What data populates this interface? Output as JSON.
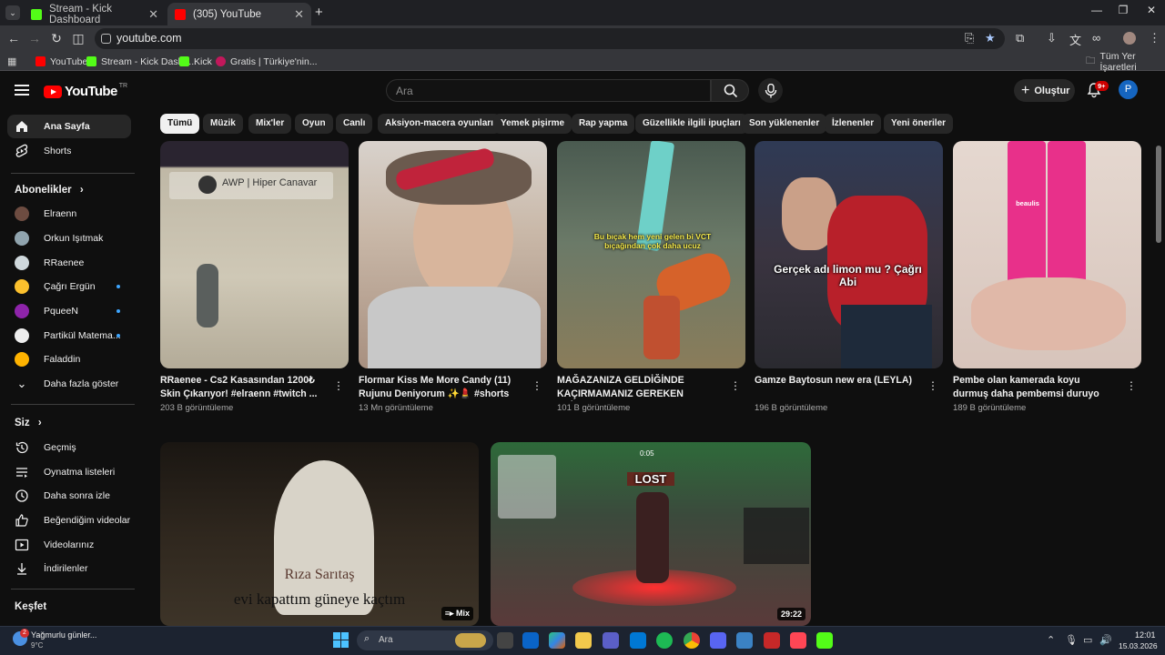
{
  "browser": {
    "tabs": [
      {
        "title": "Stream - Kick Dashboard",
        "favicon": "kick-icon",
        "active": false
      },
      {
        "title": "(305) YouTube",
        "favicon": "youtube-icon",
        "active": true
      }
    ],
    "new_tab": "+",
    "url": "youtube.com",
    "bookmarks": [
      {
        "label": "YouTube",
        "color": "#ff0000"
      },
      {
        "label": "Stream - Kick Dashb...",
        "color": "#53fc18"
      },
      {
        "label": "Kick",
        "color": "#53fc18"
      },
      {
        "label": "Gratis | Türkiye'nin...",
        "color": "#c2185b"
      }
    ],
    "all_bookmarks": "Tüm Yer İşaretleri"
  },
  "yt": {
    "logo_text": "YouTube",
    "country": "TR",
    "search_placeholder": "Ara",
    "create_label": "Oluştur",
    "notif_badge": "9+",
    "avatar_letter": "P"
  },
  "sidebar": {
    "main": [
      {
        "label": "Ana Sayfa",
        "icon": "home-icon",
        "active": true
      },
      {
        "label": "Shorts",
        "icon": "shorts-icon",
        "active": false
      }
    ],
    "subs_title": "Abonelikler",
    "subs": [
      {
        "label": "Elraenn",
        "color": "#6d4c41",
        "dot": false
      },
      {
        "label": "Orkun Işıtmak",
        "color": "#90a4ae",
        "dot": false
      },
      {
        "label": "RRaenee",
        "color": "#cfd8dc",
        "dot": false
      },
      {
        "label": "Çağrı Ergün",
        "color": "#fbc02d",
        "dot": true
      },
      {
        "label": "PqueeN",
        "color": "#8e24aa",
        "dot": true
      },
      {
        "label": "Partikül Matema...",
        "color": "#eeeeee",
        "dot": true
      },
      {
        "label": "Faladdin",
        "color": "#ffb300",
        "dot": false
      }
    ],
    "show_more": "Daha fazla göster",
    "you_title": "Siz",
    "you": [
      {
        "label": "Geçmiş",
        "icon": "history-icon"
      },
      {
        "label": "Oynatma listeleri",
        "icon": "playlist-icon"
      },
      {
        "label": "Daha sonra izle",
        "icon": "clock-icon"
      },
      {
        "label": "Beğendiğim videolar",
        "icon": "like-icon"
      },
      {
        "label": "Videolarınız",
        "icon": "video-icon"
      },
      {
        "label": "İndirilenler",
        "icon": "download-icon"
      }
    ],
    "explore_title": "Keşfet"
  },
  "chips": [
    "Tümü",
    "Müzik",
    "Mix'ler",
    "Oyun",
    "Canlı",
    "Aksiyon-macera oyunları",
    "Yemek pişirme",
    "Rap yapma",
    "Güzellikle ilgili ipuçları",
    "Son yüklenenler",
    "İzlenenler",
    "Yeni öneriler"
  ],
  "shorts": [
    {
      "title": "RRaenee - Cs2 Kasasından 1200₺ Skin Çıkarıyor! #elraenn #twitch ...",
      "views": "203 B görüntüleme",
      "overlay": "AWP | Hiper Canavar"
    },
    {
      "title": "Flormar Kiss Me More Candy (11) Rujunu Deniyorum ✨💄 #shorts",
      "views": "13 Mn görüntüleme",
      "overlay": ""
    },
    {
      "title": "MAĞAZANIZA GELDİĞİNDE KAÇIRMAMANIZ GEREKEN SKİNLER...",
      "views": "101 B görüntüleme",
      "overlay": "Bu bıçak hem yeni gelen bi VCT bıçağından çok daha ucuz"
    },
    {
      "title": "Gamze Baytosun new era (LEYLA)",
      "views": "196 B görüntüleme",
      "overlay": "Gerçek adı limon mu ? Çağrı Abi"
    },
    {
      "title": "Pembe olan kamerada koyu durmuş daha pembemsi duruyo #keşfet ...",
      "views": "189 B görüntüleme",
      "overlay": "beaulis"
    }
  ],
  "videos": [
    {
      "overlay_top": "Rıza Sarıtaş",
      "overlay": "evi kapattım güneye kaçtım",
      "badge": "Mix"
    },
    {
      "overlay": "LOST",
      "badge": "29:22",
      "timer": "0:05"
    }
  ],
  "taskbar": {
    "weather_title": "Yağmurlu günler...",
    "weather_temp": "9°C",
    "weather_badge": "2",
    "search_placeholder": "Ara",
    "time": "12:01",
    "date": "15.03.2026"
  }
}
